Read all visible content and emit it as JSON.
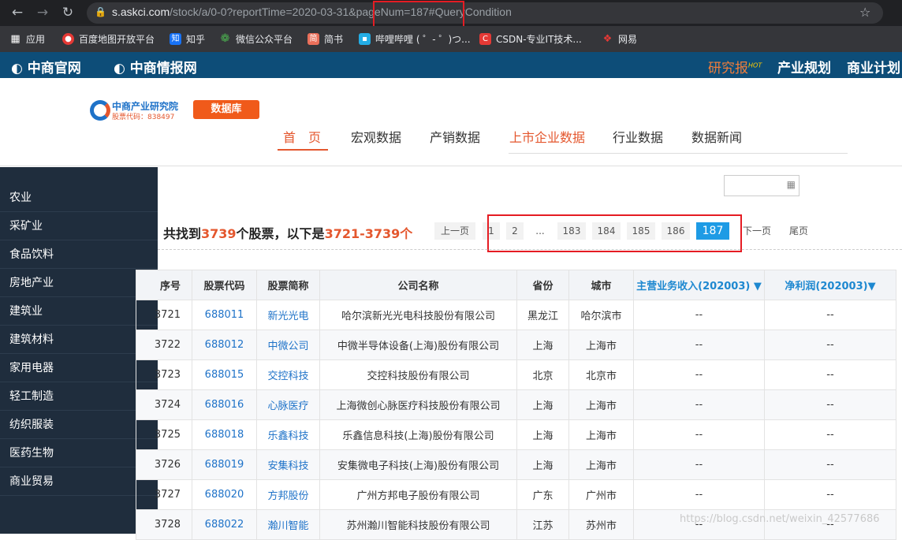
{
  "browser": {
    "url_host": "s.askci.com",
    "url_path": "/stock/a/0-0?reportTime=2020-03-31&pageNum=187#QueryCondition",
    "bookmarks": [
      {
        "label": "应用",
        "icon": "apps-icon"
      },
      {
        "label": "百度地图开放平台",
        "icon": "map-pin-icon"
      },
      {
        "label": "知乎",
        "icon": "zhihu-icon"
      },
      {
        "label": "微信公众平台",
        "icon": "wechat-icon"
      },
      {
        "label": "简书",
        "icon": "jianshu-icon"
      },
      {
        "label": "哔哩哔哩 ( ゜- ゜)つ...",
        "icon": "bilibili-icon"
      },
      {
        "label": "CSDN-专业IT技术...",
        "icon": "csdn-icon"
      },
      {
        "label": "网易",
        "icon": "netease-icon"
      }
    ]
  },
  "topnav": {
    "left": [
      "中商官网",
      "中商情报网"
    ],
    "right": [
      "研究报",
      "产业规划",
      "商业计划"
    ],
    "hot_badge": "HOT"
  },
  "header": {
    "logo_title": "中商产业研究院",
    "logo_sub": "股票代码：838497",
    "db_button": "数据库",
    "nav": [
      "首　页",
      "宏观数据",
      "产销数据",
      "上市企业数据",
      "行业数据",
      "数据新闻"
    ]
  },
  "sidebar": {
    "items": [
      "农业",
      "采矿业",
      "食品饮料",
      "房地产业",
      "建筑业",
      "建筑材料",
      "家用电器",
      "轻工制造",
      "纺织服装",
      "医药生物",
      "商业贸易"
    ]
  },
  "summary": {
    "prefix": "共找到",
    "total": "3739",
    "mid": "个股票，以下是",
    "range": "3721-3739个"
  },
  "pagination": {
    "prev": "上一页",
    "pages": [
      "1",
      "2",
      "...",
      "183",
      "184",
      "185",
      "186",
      "187"
    ],
    "current": "187",
    "next": "下一页",
    "last": "尾页"
  },
  "table": {
    "headers": [
      "序号",
      "股票代码",
      "股票简称",
      "公司名称",
      "省份",
      "城市",
      "主营业务收入(202003) ▼",
      "净利润(202003)▼"
    ],
    "rows": [
      [
        "3721",
        "688011",
        "新光光电",
        "哈尔滨新光光电科技股份有限公司",
        "黑龙江",
        "哈尔滨市",
        "--",
        "--"
      ],
      [
        "3722",
        "688012",
        "中微公司",
        "中微半导体设备(上海)股份有限公司",
        "上海",
        "上海市",
        "--",
        "--"
      ],
      [
        "3723",
        "688015",
        "交控科技",
        "交控科技股份有限公司",
        "北京",
        "北京市",
        "--",
        "--"
      ],
      [
        "3724",
        "688016",
        "心脉医疗",
        "上海微创心脉医疗科技股份有限公司",
        "上海",
        "上海市",
        "--",
        "--"
      ],
      [
        "3725",
        "688018",
        "乐鑫科技",
        "乐鑫信息科技(上海)股份有限公司",
        "上海",
        "上海市",
        "--",
        "--"
      ],
      [
        "3726",
        "688019",
        "安集科技",
        "安集微电子科技(上海)股份有限公司",
        "上海",
        "上海市",
        "--",
        "--"
      ],
      [
        "3727",
        "688020",
        "方邦股份",
        "广州方邦电子股份有限公司",
        "广东",
        "广州市",
        "--",
        "--"
      ],
      [
        "3728",
        "688022",
        "瀚川智能",
        "苏州瀚川智能科技股份有限公司",
        "江苏",
        "苏州市",
        "--",
        "--"
      ]
    ]
  },
  "watermark": "https://blog.csdn.net/weixin_42577686",
  "colors": {
    "accent": "#e4572e",
    "nav_bg": "#0d4d78",
    "sidebar_bg": "#1f2d3d",
    "page_current": "#1e9be5",
    "highlight_box": "#e51c23"
  }
}
